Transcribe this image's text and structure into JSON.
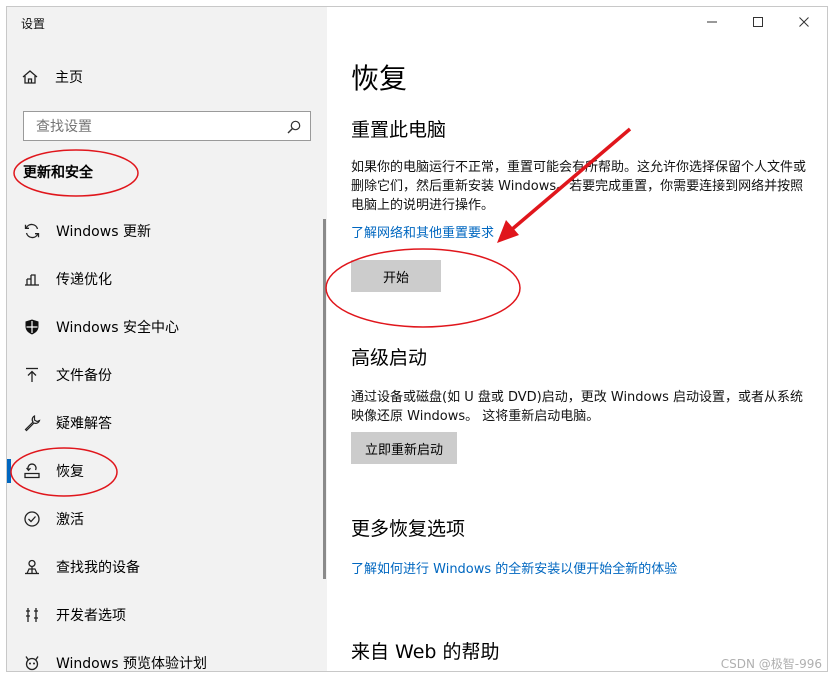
{
  "window": {
    "title": "设置"
  },
  "sidebar": {
    "home_label": "主页",
    "search_placeholder": "查找设置",
    "section_title": "更新和安全",
    "items": [
      {
        "label": "Windows 更新",
        "icon": "sync-icon"
      },
      {
        "label": "传递优化",
        "icon": "delivery-icon"
      },
      {
        "label": "Windows 安全中心",
        "icon": "shield-icon"
      },
      {
        "label": "文件备份",
        "icon": "backup-icon"
      },
      {
        "label": "疑难解答",
        "icon": "wrench-icon"
      },
      {
        "label": "恢复",
        "icon": "recovery-icon",
        "active": true
      },
      {
        "label": "激活",
        "icon": "check-circle-icon"
      },
      {
        "label": "查找我的设备",
        "icon": "find-device-icon"
      },
      {
        "label": "开发者选项",
        "icon": "developer-icon"
      },
      {
        "label": "Windows 预览体验计划",
        "icon": "insider-icon"
      }
    ]
  },
  "main": {
    "title": "恢复",
    "reset": {
      "heading": "重置此电脑",
      "description": "如果你的电脑运行不正常，重置可能会有所帮助。这允许你选择保留个人文件或删除它们，然后重新安装 Windows。若要完成重置，你需要连接到网络并按照电脑上的说明进行操作。",
      "link": "了解网络和其他重置要求",
      "button": "开始"
    },
    "advanced": {
      "heading": "高级启动",
      "description": "通过设备或磁盘(如 U 盘或 DVD)启动，更改 Windows 启动设置，或者从系统映像还原 Windows。 这将重新启动电脑。",
      "button": "立即重新启动"
    },
    "more": {
      "heading": "更多恢复选项",
      "link": "了解如何进行 Windows 的全新安装以便开始全新的体验"
    },
    "web_help": {
      "heading": "来自 Web 的帮助"
    }
  },
  "watermark": "CSDN @极智-996",
  "colors": {
    "accent": "#0067c0",
    "annotation": "#e0161c",
    "sidebar_bg": "#f2f2f2",
    "button_bg": "#cccccc"
  }
}
